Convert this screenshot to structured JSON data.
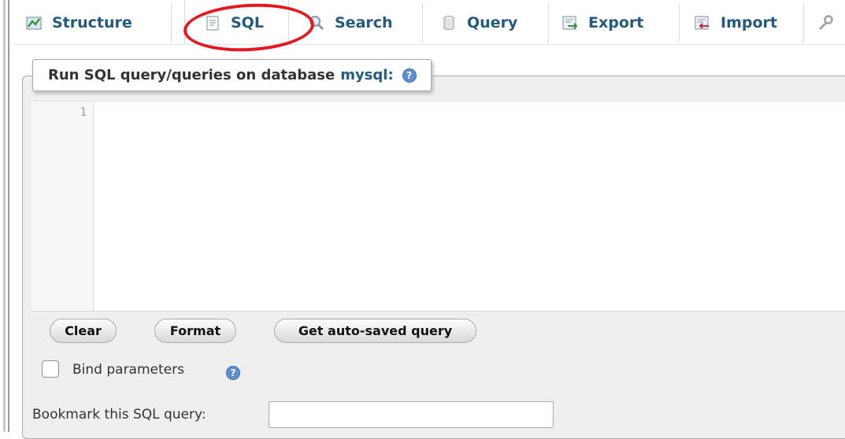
{
  "tabs": [
    {
      "label": "Structure",
      "icon": "structure-icon"
    },
    {
      "label": "SQL",
      "icon": "sql-icon"
    },
    {
      "label": "Search",
      "icon": "search-icon"
    },
    {
      "label": "Query",
      "icon": "query-icon"
    },
    {
      "label": "Export",
      "icon": "export-icon"
    },
    {
      "label": "Import",
      "icon": "import-icon"
    }
  ],
  "fieldset": {
    "legend_prefix": "Run SQL query/queries on database",
    "database": "mysql:",
    "help_glyph": "?"
  },
  "editor": {
    "line_number": "1",
    "content": ""
  },
  "buttons": {
    "clear": "Clear",
    "format": "Format",
    "autosaved": "Get auto-saved query"
  },
  "bind_parameters": {
    "label": "Bind parameters",
    "checked": false
  },
  "bookmark": {
    "label": "Bookmark this SQL query:",
    "value": ""
  },
  "colors": {
    "link": "#235a81",
    "annotation": "#e8171f",
    "panel": "#efefef"
  }
}
